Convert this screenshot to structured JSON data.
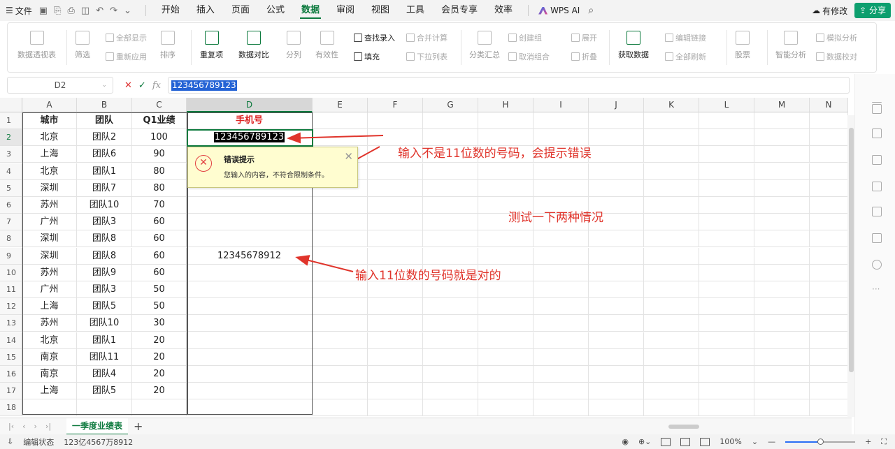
{
  "menubar": {
    "file_label": "文件",
    "tabs": [
      {
        "label": "开始",
        "active": false
      },
      {
        "label": "插入",
        "active": false
      },
      {
        "label": "页面",
        "active": false
      },
      {
        "label": "公式",
        "active": false
      },
      {
        "label": "数据",
        "active": true
      },
      {
        "label": "审阅",
        "active": false
      },
      {
        "label": "视图",
        "active": false
      },
      {
        "label": "工具",
        "active": false
      },
      {
        "label": "会员专享",
        "active": false
      },
      {
        "label": "效率",
        "active": false
      }
    ],
    "wps_ai": "WPS AI",
    "modified": "有修改",
    "share": "分享",
    "accent_color": "#0d7a3e"
  },
  "ribbon": {
    "pivot": "数据透视表",
    "filter": "筛选",
    "show_all": "全部显示",
    "reapply": "重新应用",
    "sort": "排序",
    "duplicates": "重复项",
    "compare": "数据对比",
    "split": "分列",
    "validity": "有效性",
    "lookup_entry": "查找录入",
    "fill": "填充",
    "merge_calc": "合并计算",
    "dropdown_list": "下拉列表",
    "subtotal": "分类汇总",
    "create_group": "创建组",
    "ungroup": "取消组合",
    "expand": "展开",
    "collapse": "折叠",
    "get_data": "获取数据",
    "edit_links": "编辑链接",
    "refresh_all": "全部刷新",
    "stocks": "股票",
    "smart_analysis": "智能分析",
    "simulation": "模拟分析",
    "data_check": "数据校对"
  },
  "formula_bar": {
    "name_box": "D2",
    "content": "123456789123"
  },
  "grid": {
    "columns": [
      "A",
      "B",
      "C",
      "D",
      "E",
      "F",
      "G",
      "H",
      "I",
      "J",
      "K",
      "L",
      "M",
      "N"
    ],
    "row_numbers": [
      "1",
      "2",
      "3",
      "4",
      "5",
      "6",
      "7",
      "8",
      "9",
      "10",
      "11",
      "12",
      "13",
      "14",
      "15",
      "16",
      "17",
      "18"
    ],
    "headers": [
      "城市",
      "团队",
      "Q1业绩",
      "手机号"
    ],
    "rows": [
      [
        "北京",
        "团队2",
        "100",
        "123456789123"
      ],
      [
        "上海",
        "团队6",
        "90",
        ""
      ],
      [
        "北京",
        "团队1",
        "80",
        ""
      ],
      [
        "深圳",
        "团队7",
        "80",
        ""
      ],
      [
        "苏州",
        "团队10",
        "70",
        ""
      ],
      [
        "广州",
        "团队3",
        "60",
        ""
      ],
      [
        "深圳",
        "团队8",
        "60",
        ""
      ],
      [
        "深圳",
        "团队8",
        "60",
        "12345678912"
      ],
      [
        "苏州",
        "团队9",
        "60",
        ""
      ],
      [
        "广州",
        "团队3",
        "50",
        ""
      ],
      [
        "上海",
        "团队5",
        "50",
        ""
      ],
      [
        "苏州",
        "团队10",
        "30",
        ""
      ],
      [
        "北京",
        "团队1",
        "20",
        ""
      ],
      [
        "南京",
        "团队11",
        "20",
        ""
      ],
      [
        "南京",
        "团队4",
        "20",
        ""
      ],
      [
        "上海",
        "团队5",
        "20",
        ""
      ]
    ]
  },
  "error_popup": {
    "title": "错误提示",
    "message": "您输入的内容，不符合限制条件。"
  },
  "annotations": {
    "wrong": "输入不是11位数的号码，会提示错误",
    "test": "测试一下两种情况",
    "right": "输入11位数的号码就是对的",
    "color": "#e0342b"
  },
  "sheet": {
    "tab": "一季度业绩表"
  },
  "status": {
    "mode": "编辑状态",
    "value_display": "123亿4567万8912",
    "zoom": "100%"
  }
}
